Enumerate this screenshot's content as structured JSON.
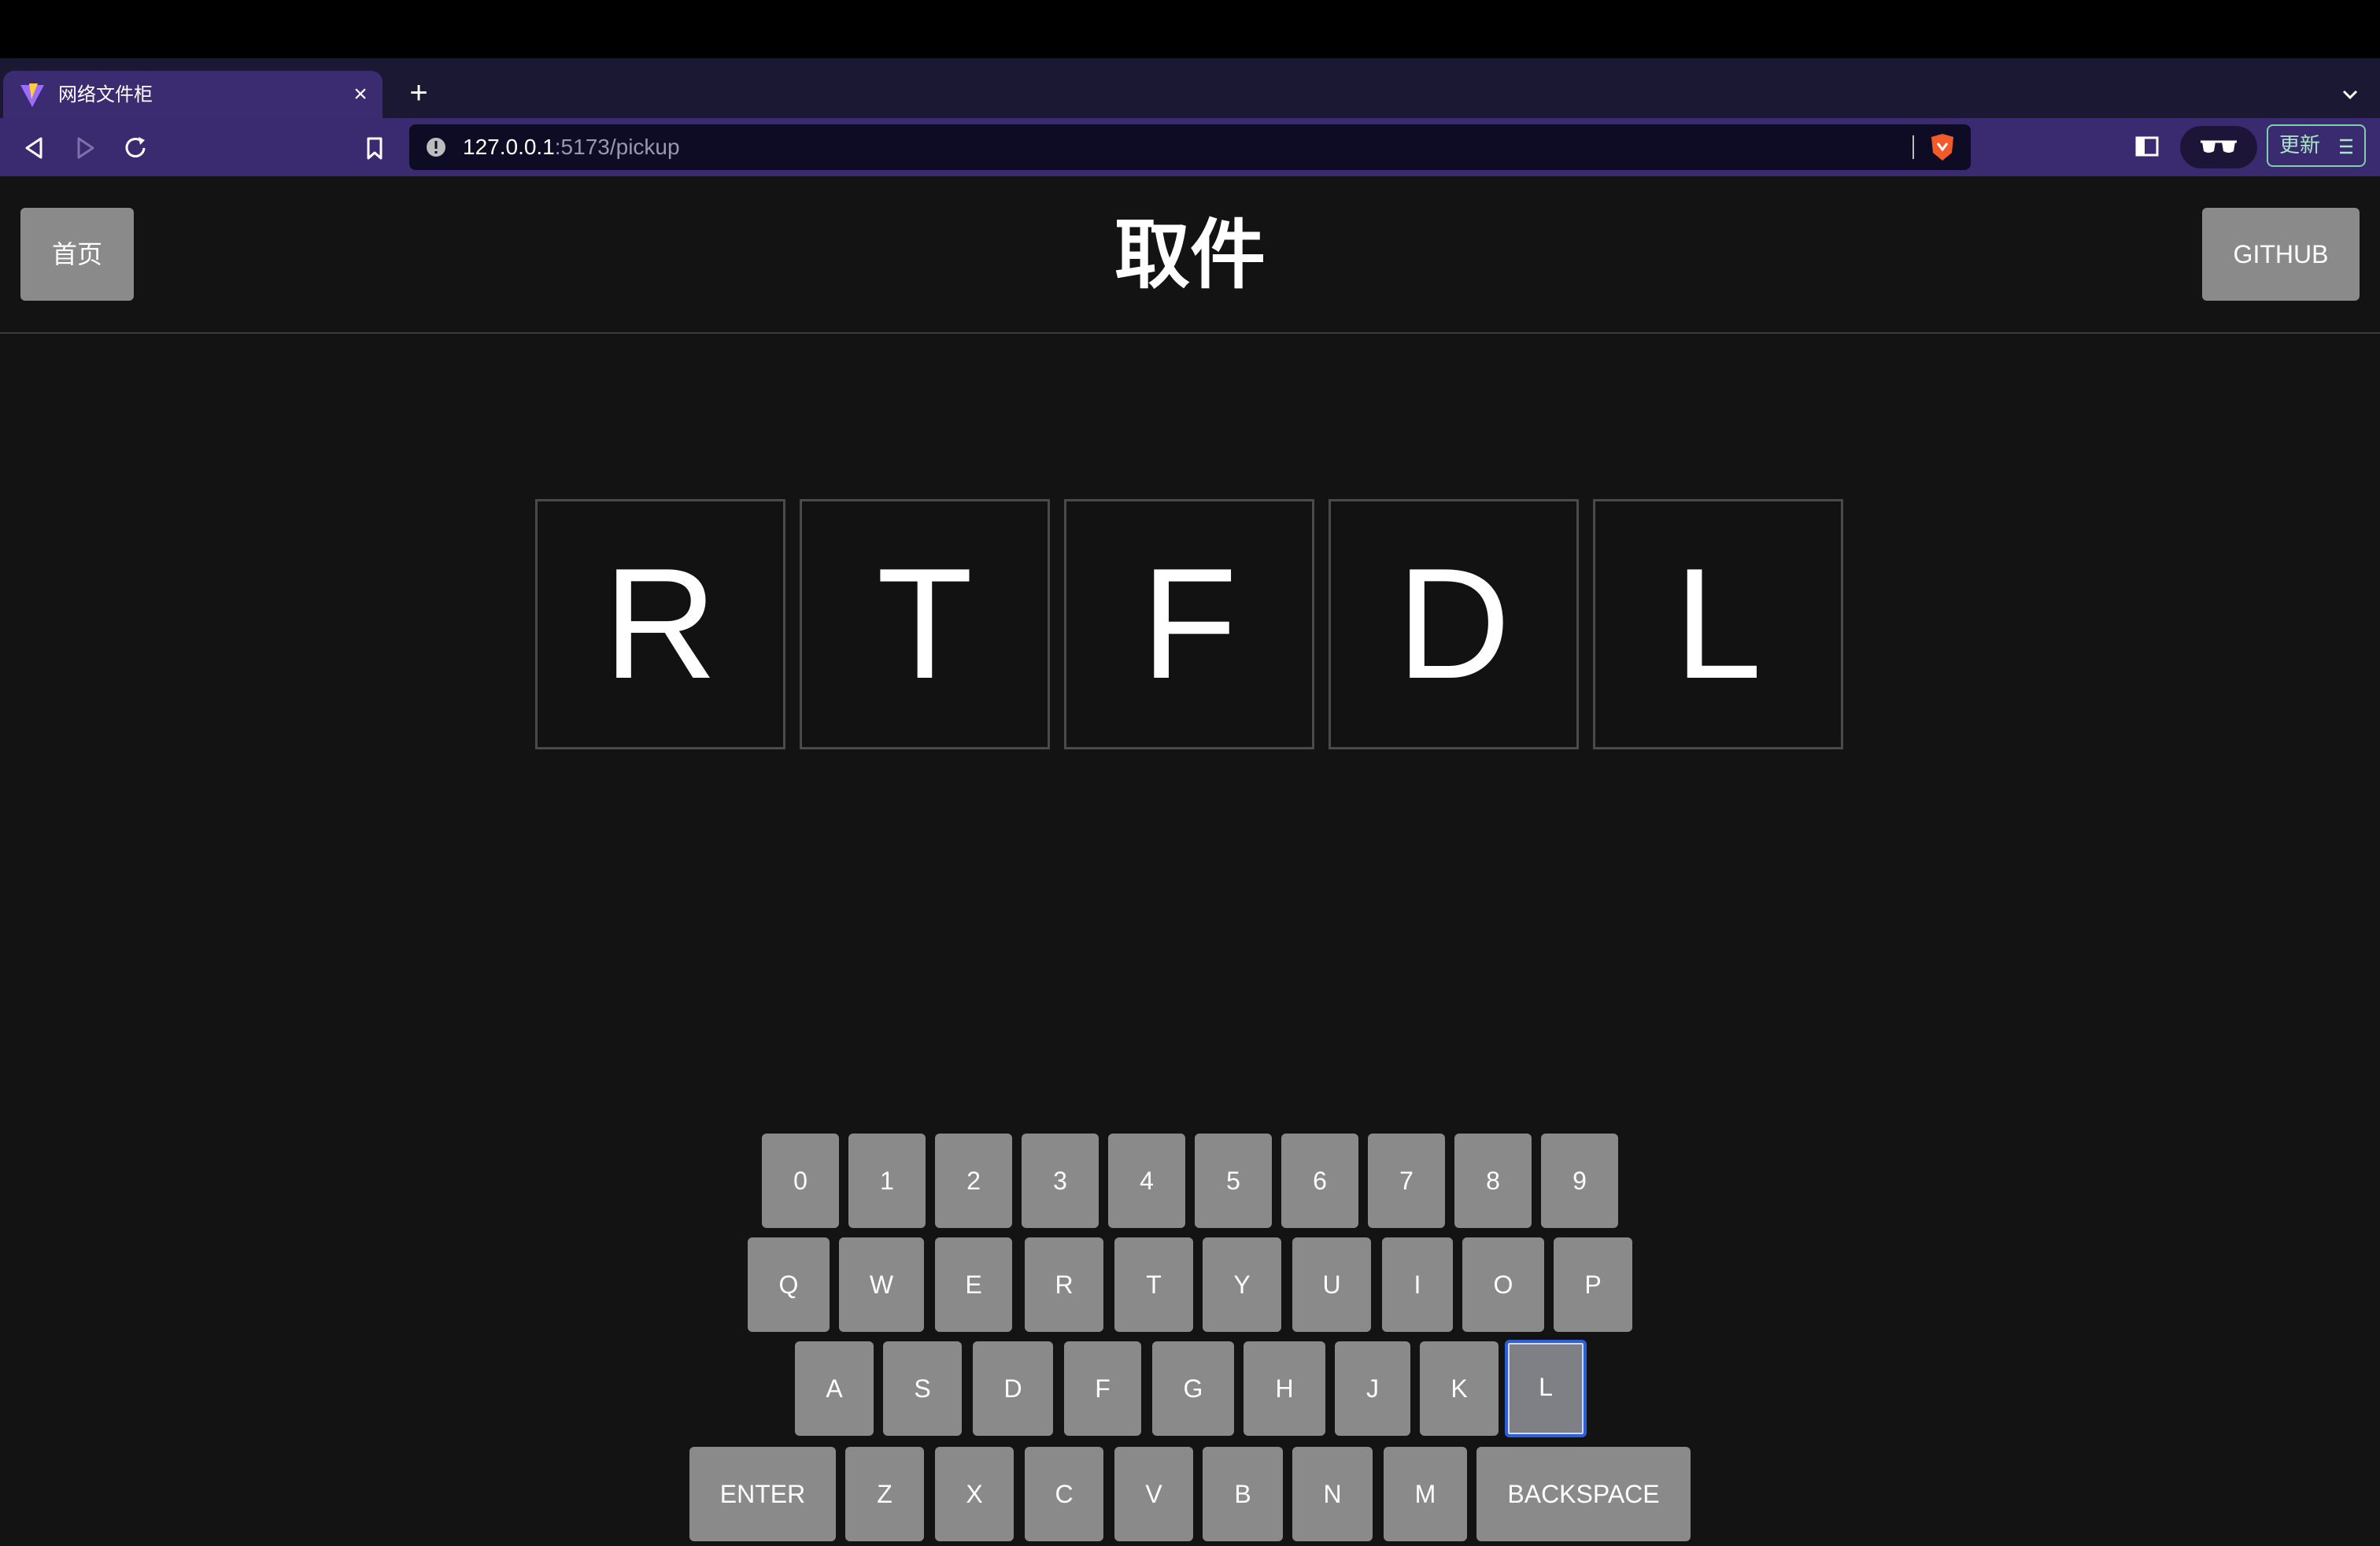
{
  "browser": {
    "tab_title": "网络文件柜",
    "url_host": "127.0.0.1",
    "url_rest": ":5173/pickup",
    "update_label": "更新"
  },
  "header": {
    "home_label": "首页",
    "title": "取件",
    "github_label": "GITHUB"
  },
  "code": [
    "R",
    "T",
    "F",
    "D",
    "L"
  ],
  "keyboard": {
    "row1": [
      "0",
      "1",
      "2",
      "3",
      "4",
      "5",
      "6",
      "7",
      "8",
      "9"
    ],
    "row2": [
      "Q",
      "W",
      "E",
      "R",
      "T",
      "Y",
      "U",
      "I",
      "O",
      "P"
    ],
    "row3": [
      "A",
      "S",
      "D",
      "F",
      "G",
      "H",
      "J",
      "K",
      "L"
    ],
    "row4": [
      "ENTER",
      "Z",
      "X",
      "C",
      "V",
      "B",
      "N",
      "M",
      "BACKSPACE"
    ],
    "active_key": "L"
  },
  "colors": {
    "tab_active": "#3b2c72",
    "nav_bg": "#3a2a70",
    "key_bg": "#8a8a8a",
    "key_focus": "#2d5fd6",
    "page_bg": "#131313"
  }
}
